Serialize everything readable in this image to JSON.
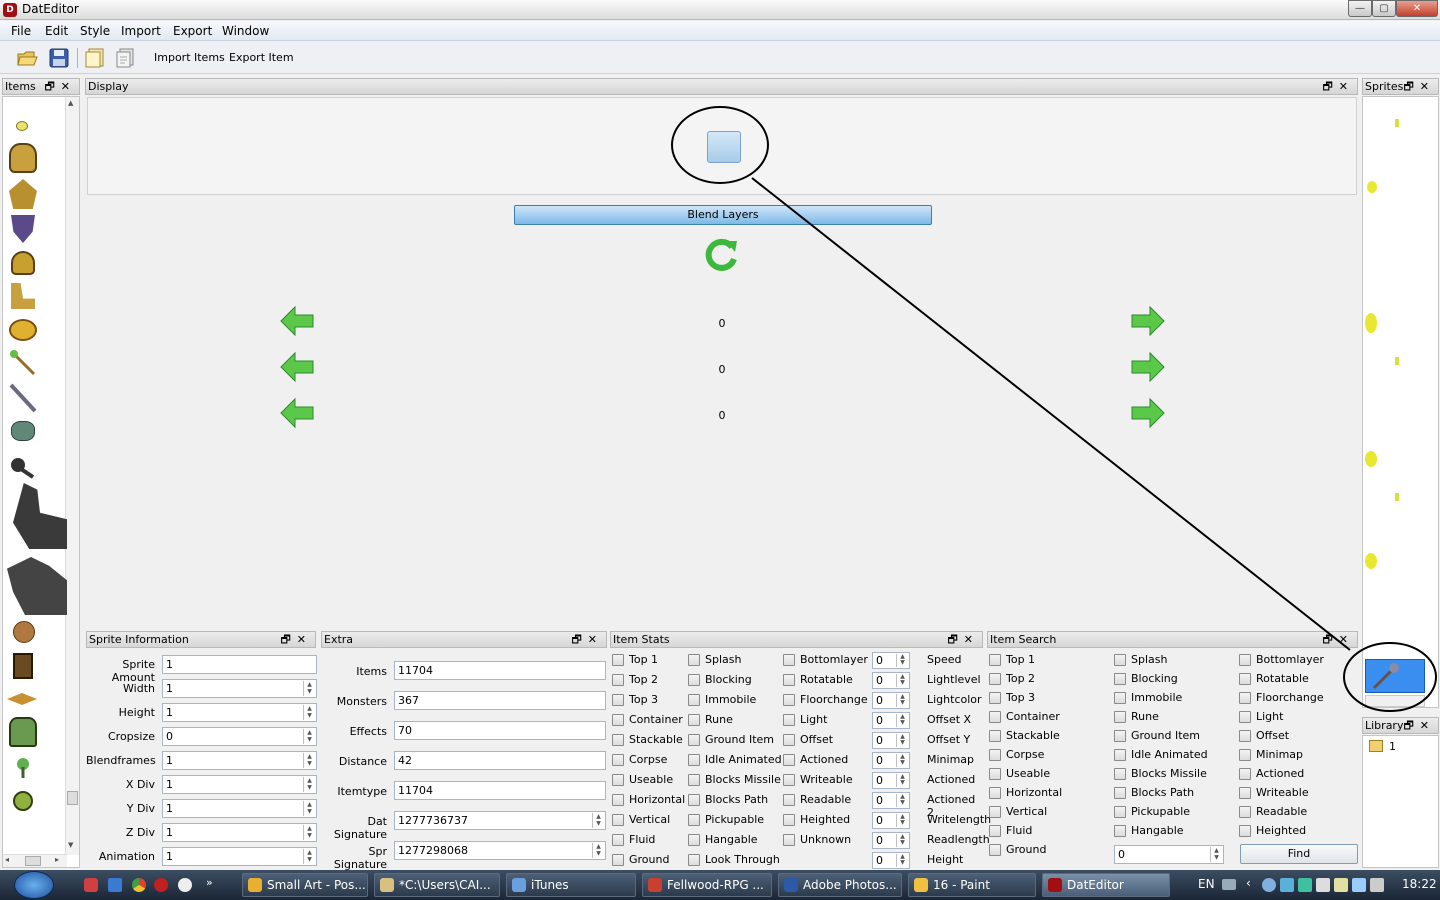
{
  "window": {
    "title": "DatEditor",
    "icon": "dateditor-icon",
    "controls": {
      "minimize": "—",
      "maximize": "▢",
      "close": "✕"
    }
  },
  "menu": [
    "File",
    "Edit",
    "Style",
    "Import",
    "Export",
    "Window"
  ],
  "toolbar": {
    "icons": [
      "open-icon",
      "save-icon",
      "import-icon",
      "export-icon"
    ],
    "import_label": "Import Items",
    "export_label": "Export Item"
  },
  "panel_controls": {
    "float": "🗗",
    "close": "✕"
  },
  "items_panel": {
    "title": "Items",
    "scroll_up": "▲",
    "scroll_down": "▼",
    "scroll_left": "◂",
    "scroll_right": "▸"
  },
  "display": {
    "title": "Display",
    "blend_button": "Blend Layers",
    "rotate_icon": "rotate-icon",
    "counters": [
      "0",
      "0",
      "0"
    ],
    "left_arrow": "⬅",
    "right_arrow": "➡"
  },
  "sprites_panel": {
    "title": "Sprites"
  },
  "library": {
    "title": "Library",
    "entry": "1"
  },
  "sprite_info": {
    "title": "Sprite Information",
    "fields": [
      {
        "label": "Sprite Amount",
        "value": "1",
        "spin": false
      },
      {
        "label": "Width",
        "value": "1",
        "spin": true
      },
      {
        "label": "Height",
        "value": "1",
        "spin": true
      },
      {
        "label": "Cropsize",
        "value": "0",
        "spin": true
      },
      {
        "label": "Blendframes",
        "value": "1",
        "spin": true
      },
      {
        "label": "X Div",
        "value": "1",
        "spin": true
      },
      {
        "label": "Y Div",
        "value": "1",
        "spin": true
      },
      {
        "label": "Z Div",
        "value": "1",
        "spin": true
      },
      {
        "label": "Animation",
        "value": "1",
        "spin": true
      }
    ]
  },
  "extra": {
    "title": "Extra",
    "fields": [
      {
        "label": "Items",
        "value": "11704",
        "spin": false
      },
      {
        "label": "Monsters",
        "value": "367",
        "spin": false
      },
      {
        "label": "Effects",
        "value": "70",
        "spin": false
      },
      {
        "label": "Distance",
        "value": "42",
        "spin": false
      },
      {
        "label": "Itemtype",
        "value": "11704",
        "spin": false
      },
      {
        "label": "Dat Signature",
        "value": "1277736737",
        "spin": true
      },
      {
        "label": "Spr Signature",
        "value": "1277298068",
        "spin": true
      }
    ]
  },
  "item_stats": {
    "title": "Item Stats",
    "col1": [
      "Top 1",
      "Top 2",
      "Top 3",
      "Container",
      "Stackable",
      "Corpse",
      "Useable",
      "Horizontal",
      "Vertical",
      "Fluid",
      "Ground"
    ],
    "col2": [
      "Splash",
      "Blocking",
      "Immobile",
      "Rune",
      "Ground Item",
      "Idle Animated",
      "Blocks Missile",
      "Blocks Path",
      "Pickupable",
      "Hangable",
      "Look Through"
    ],
    "col3": [
      "Bottomlayer",
      "Rotatable",
      "Floorchange",
      "Light",
      "Offset",
      "Actioned",
      "Writeable",
      "Readable",
      "Heighted",
      "Unknown"
    ],
    "spin_values": [
      "0",
      "0",
      "0",
      "0",
      "0",
      "0",
      "0",
      "0",
      "0",
      "0",
      "0"
    ],
    "spin_labels": [
      "Speed",
      "Lightlevel",
      "Lightcolor",
      "Offset X",
      "Offset Y",
      "Minimap",
      "Actioned",
      "Actioned 2",
      "Writelength",
      "Readlength",
      "Height"
    ]
  },
  "item_search": {
    "title": "Item Search",
    "col1": [
      "Top 1",
      "Top 2",
      "Top 3",
      "Container",
      "Stackable",
      "Corpse",
      "Useable",
      "Horizontal",
      "Vertical",
      "Fluid",
      "Ground"
    ],
    "col2": [
      "Splash",
      "Blocking",
      "Immobile",
      "Rune",
      "Ground Item",
      "Idle Animated",
      "Blocks Missile",
      "Blocks Path",
      "Pickupable",
      "Hangable"
    ],
    "col3": [
      "Bottomlayer",
      "Rotatable",
      "Floorchange",
      "Light",
      "Offset",
      "Minimap",
      "Actioned",
      "Writeable",
      "Readable",
      "Heighted"
    ],
    "search_value": "0",
    "find_button": "Find"
  },
  "taskbar": {
    "start": "start-orb",
    "tasks": [
      {
        "label": "Small Art - Pos...",
        "color": "#e8b030"
      },
      {
        "label": "*C:\\Users\\CAI...",
        "color": "#d8c080"
      },
      {
        "label": "iTunes",
        "color": "#6aa0e0"
      },
      {
        "label": "Fellwood-RPG ...",
        "color": "#c84030"
      },
      {
        "label": "Adobe Photos...",
        "color": "#2a5aa8"
      },
      {
        "label": "16 - Paint",
        "color": "#f0c040"
      },
      {
        "label": "DatEditor",
        "color": "#a01010"
      }
    ],
    "lang": "EN",
    "clock": "18:22"
  }
}
